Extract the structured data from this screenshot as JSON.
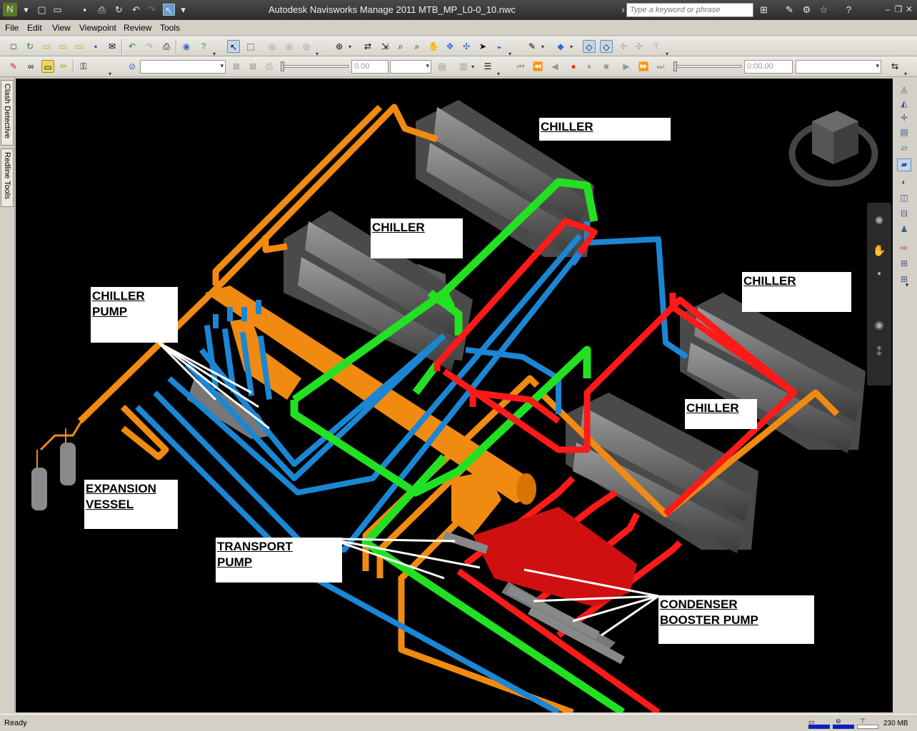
{
  "window": {
    "title": "Autodesk Navisworks Manage 2011     MTB_MP_L0-0_10.nwc",
    "search_placeholder": "Type a keyword or phrase"
  },
  "menu": [
    "File",
    "Edit",
    "View",
    "Viewpoint",
    "Review",
    "Tools"
  ],
  "toolbar2": {
    "value_field": "0.00",
    "time_field": "0:00.00"
  },
  "left_tabs": [
    "Clash Detective",
    "Redline Tools"
  ],
  "labels": {
    "chiller_1": "CHILLER",
    "chiller_2": "CHILLER",
    "chiller_3": "CHILLER",
    "chiller_4": "CHILLER",
    "chiller_pump": "CHILLER\nPUMP",
    "expansion_vessel": "EXPANSION\nVESSEL",
    "transport_pump": "TRANSPORT\nPUMP",
    "condenser_booster_pump": "CONDENSER\nBOOSTER PUMP"
  },
  "colors": {
    "chilled_water_pipe": "#1a86d4",
    "condenser_pipe": "#f08a10",
    "supply_pipe_green": "#22e022",
    "hot_pipe_red": "#ff1a1a",
    "equipment_grey": "#8c8c8c",
    "background": "#000000"
  },
  "status": {
    "text": "Ready",
    "memory": "230 MB"
  }
}
